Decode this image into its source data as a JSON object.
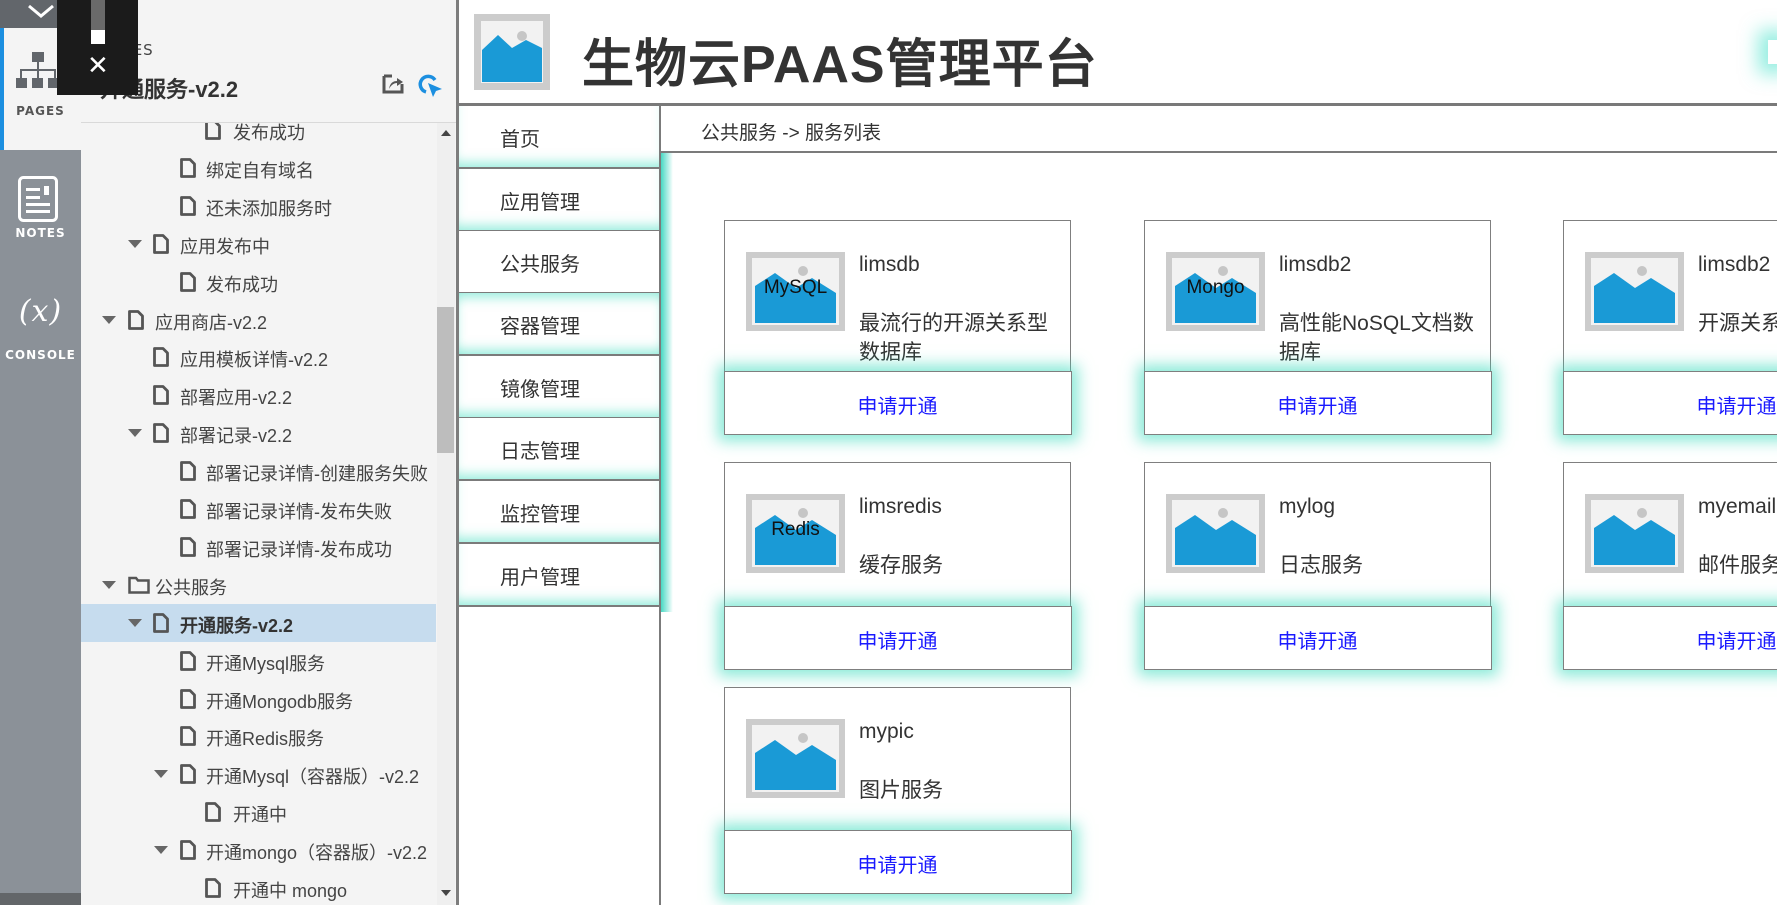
{
  "rail": {
    "tabs": [
      {
        "label": "PAGES",
        "icon": "sitemap-icon",
        "active": true
      },
      {
        "label": "NOTES",
        "icon": "notes-icon",
        "active": false
      },
      {
        "label": "CONSOLE",
        "icon": "variable-x-icon",
        "active": false
      }
    ],
    "collapse_icon": "chevron-down-icon"
  },
  "tree_panel": {
    "section_label": "PAGES",
    "current_page_title": "开通服务-v2.2",
    "popout_icon": "popout-icon",
    "select_icon": "cursor-select-icon",
    "rows": [
      {
        "label": "发布成功",
        "level": 3,
        "expanded": null,
        "icon": "page",
        "selected": false
      },
      {
        "label": "绑定自有域名",
        "level": 2,
        "expanded": null,
        "icon": "page",
        "selected": false
      },
      {
        "label": "还未添加服务时",
        "level": 2,
        "expanded": null,
        "icon": "page",
        "selected": false
      },
      {
        "label": "应用发布中",
        "level": 1,
        "expanded": true,
        "icon": "page",
        "selected": false
      },
      {
        "label": "发布成功",
        "level": 2,
        "expanded": null,
        "icon": "page",
        "selected": false
      },
      {
        "label": "应用商店-v2.2",
        "level": 0,
        "expanded": true,
        "icon": "page",
        "selected": false
      },
      {
        "label": "应用模板详情-v2.2",
        "level": 1,
        "expanded": null,
        "icon": "page",
        "selected": false
      },
      {
        "label": "部署应用-v2.2",
        "level": 1,
        "expanded": null,
        "icon": "page",
        "selected": false
      },
      {
        "label": "部署记录-v2.2",
        "level": 1,
        "expanded": true,
        "icon": "page",
        "selected": false
      },
      {
        "label": "部署记录详情-创建服务失败",
        "level": 2,
        "expanded": null,
        "icon": "page",
        "selected": false
      },
      {
        "label": "部署记录详情-发布失败",
        "level": 2,
        "expanded": null,
        "icon": "page",
        "selected": false
      },
      {
        "label": "部署记录详情-发布成功",
        "level": 2,
        "expanded": null,
        "icon": "page",
        "selected": false
      },
      {
        "label": "公共服务",
        "level": 0,
        "expanded": true,
        "icon": "folder",
        "selected": false
      },
      {
        "label": "开通服务-v2.2",
        "level": 1,
        "expanded": true,
        "icon": "page",
        "selected": true
      },
      {
        "label": "开通Mysql服务",
        "level": 2,
        "expanded": null,
        "icon": "page",
        "selected": false
      },
      {
        "label": "开通Mongodb服务",
        "level": 2,
        "expanded": null,
        "icon": "page",
        "selected": false
      },
      {
        "label": "开通Redis服务",
        "level": 2,
        "expanded": null,
        "icon": "page",
        "selected": false
      },
      {
        "label": "开通Mysql（容器版）-v2.2",
        "level": 2,
        "expanded": true,
        "icon": "page",
        "selected": false
      },
      {
        "label": "开通中",
        "level": 3,
        "expanded": null,
        "icon": "page",
        "selected": false
      },
      {
        "label": "开通mongo（容器版）-v2.2",
        "level": 2,
        "expanded": true,
        "icon": "page",
        "selected": false
      },
      {
        "label": "开通中 mongo",
        "level": 3,
        "expanded": null,
        "icon": "page",
        "selected": false
      }
    ]
  },
  "overlay": {
    "close_icon": "close-icon"
  },
  "app": {
    "title": "生物云PAAS管理平台",
    "logo_icon": "image-placeholder-icon",
    "nav": [
      {
        "label": "首页"
      },
      {
        "label": "应用管理"
      },
      {
        "label": "公共服务"
      },
      {
        "label": "容器管理"
      },
      {
        "label": "镜像管理"
      },
      {
        "label": "日志管理"
      },
      {
        "label": "监控管理"
      },
      {
        "label": "用户管理"
      }
    ],
    "breadcrumb": "公共服务 -> 服务列表",
    "cards": [
      {
        "name": "limsdb",
        "desc": "最流行的开源关系型数据库",
        "img_label": "MySQL",
        "button": "申请开通"
      },
      {
        "name": "limsdb2",
        "desc": "高性能NoSQL文档数据库",
        "img_label": "Mongo",
        "button": "申请开通"
      },
      {
        "name": "limsdb2",
        "desc": "开源关系",
        "img_label": "",
        "button": "申请开通"
      },
      {
        "name": "limsredis",
        "desc": "缓存服务",
        "img_label": "Redis",
        "button": "申请开通"
      },
      {
        "name": "mylog",
        "desc": "日志服务",
        "img_label": "",
        "button": "申请开通"
      },
      {
        "name": "myemail",
        "desc": "邮件服务",
        "img_label": "",
        "button": "申请开通"
      },
      {
        "name": "mypic",
        "desc": "图片服务",
        "img_label": "",
        "button": "申请开通"
      }
    ]
  },
  "colors": {
    "accent_blue": "#1c8fe0",
    "link_blue": "#1a1aff",
    "glow_teal": "#3cdcbe",
    "image_blue": "#1a9ad6",
    "selected_row": "#c6dcee"
  }
}
